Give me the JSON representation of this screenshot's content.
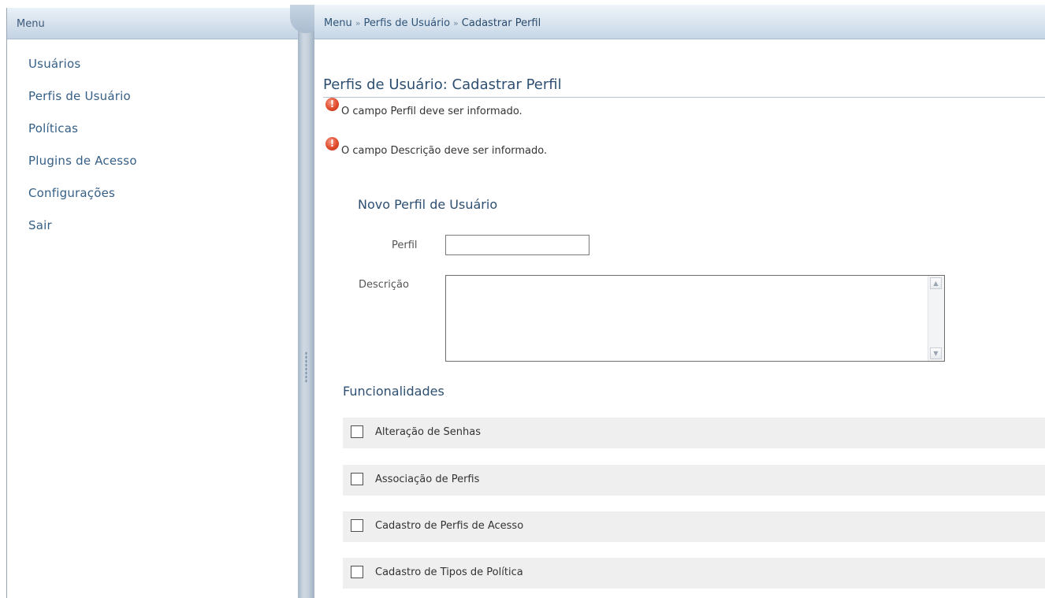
{
  "sidebar": {
    "title": "Menu",
    "items": [
      {
        "label": "Usuários"
      },
      {
        "label": "Perfis de Usuário"
      },
      {
        "label": "Políticas"
      },
      {
        "label": "Plugins de Acesso"
      },
      {
        "label": "Configurações"
      },
      {
        "label": "Sair"
      }
    ]
  },
  "breadcrumb": {
    "items": [
      "Menu",
      "Perfis de Usuário",
      "Cadastrar Perfil"
    ],
    "separator": "»"
  },
  "page": {
    "title": "Perfis de Usuário: Cadastrar Perfil"
  },
  "errors": [
    "O campo Perfil deve ser informado.",
    "O campo Descrição deve ser informado."
  ],
  "form": {
    "section_title": "Novo Perfil de Usuário",
    "perfil_label": "Perfil",
    "perfil_value": "",
    "descricao_label": "Descrição",
    "descricao_value": ""
  },
  "funcionalidades": {
    "title": "Funcionalidades",
    "items": [
      {
        "label": "Alteração de Senhas",
        "checked": false
      },
      {
        "label": "Associação de Perfis",
        "checked": false
      },
      {
        "label": "Cadastro de Perfis de Acesso",
        "checked": false
      },
      {
        "label": "Cadastro de Tipos de Política",
        "checked": false
      }
    ]
  },
  "colors": {
    "link": "#355f86",
    "header_gradient": "#d4e0ec",
    "error": "#e04a2b",
    "row_background": "#efefef"
  },
  "icons": [
    "error-icon",
    "checkbox-icon",
    "scroll-up-icon",
    "scroll-down-icon"
  ]
}
